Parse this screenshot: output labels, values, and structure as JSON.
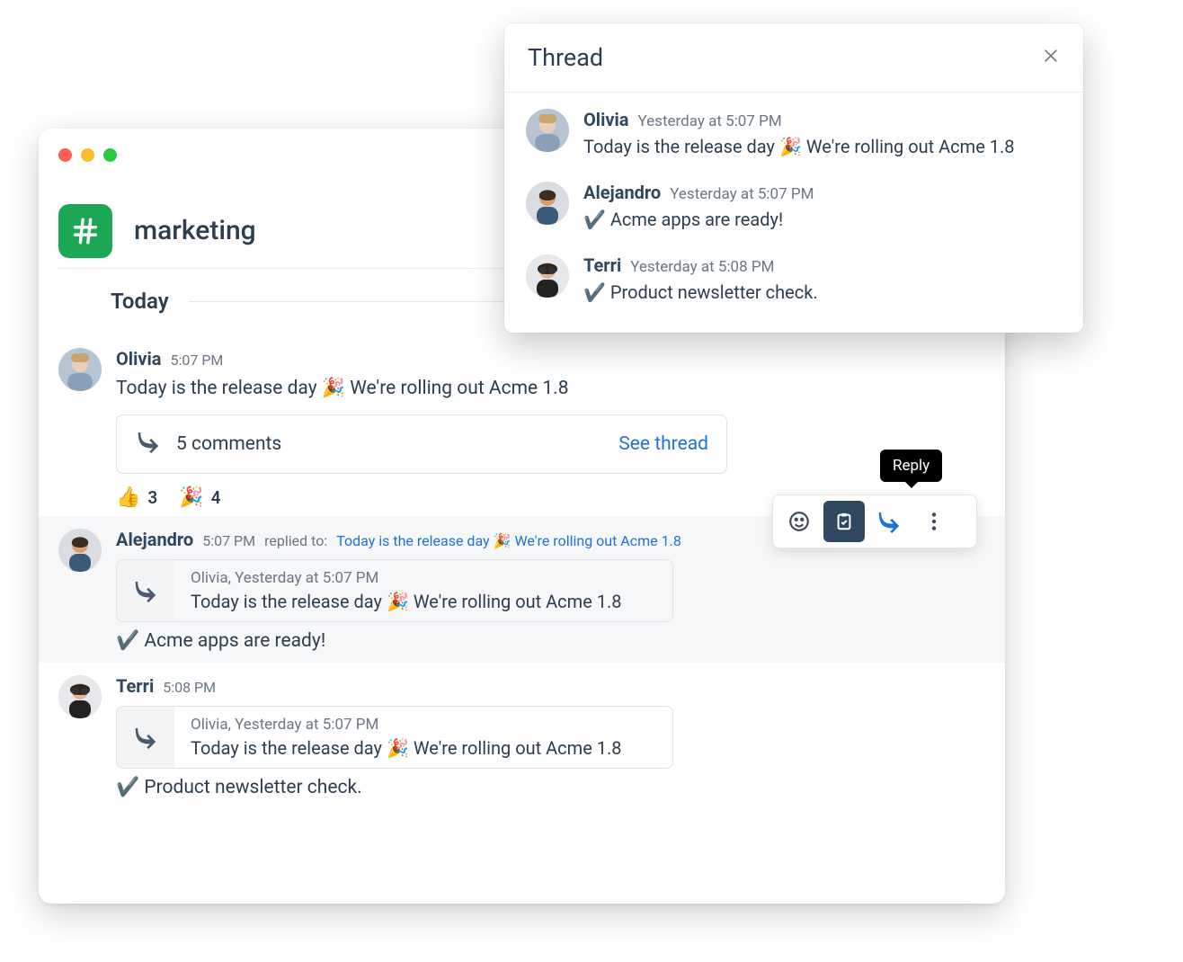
{
  "channel": {
    "name": "marketing",
    "icon": "hash-icon"
  },
  "divider_label": "Today",
  "icons": {
    "party": "🎉",
    "thumbs_up": "👍",
    "check": "✔️"
  },
  "messages": [
    {
      "author": "Olivia",
      "time": "5:07 PM",
      "text_pre": "Today is the release day ",
      "text_emoji": "🎉",
      "text_post": " We're rolling out Acme 1.8",
      "thread": {
        "count_label": "5 comments",
        "link_label": "See thread"
      },
      "reactions": [
        {
          "emoji": "👍",
          "count": "3"
        },
        {
          "emoji": "🎉",
          "count": "4"
        }
      ]
    },
    {
      "author": "Alejandro",
      "time": "5:07 PM",
      "replied_label": "replied to:",
      "replied_to_pre": "Today is the release day ",
      "replied_to_emoji": "🎉",
      "replied_to_post": " We're rolling out Acme 1.8",
      "quote": {
        "meta": "Olivia, Yesterday at 5:07 PM",
        "text_pre": "Today is the release day ",
        "text_emoji": "🎉",
        "text_post": " We're rolling out Acme 1.8"
      },
      "reply_emoji": "✔️",
      "reply_text": " Acme apps are ready!"
    },
    {
      "author": "Terri",
      "time": "5:08 PM",
      "quote": {
        "meta": "Olivia, Yesterday at 5:07 PM",
        "text_pre": "Today is the release day ",
        "text_emoji": "🎉",
        "text_post": " We're rolling out Acme 1.8"
      },
      "reply_emoji": "✔️",
      "reply_text": " Product newsletter check."
    }
  ],
  "thread_pop": {
    "title": "Thread",
    "items": [
      {
        "author": "Olivia",
        "time": "Yesterday at 5:07 PM",
        "text_pre": "Today is the release day ",
        "text_emoji": "🎉",
        "text_post": " We're rolling out Acme 1.8"
      },
      {
        "author": "Alejandro",
        "time": "Yesterday at 5:07 PM",
        "text_emoji": "✔️",
        "text_post": " Acme apps are ready!"
      },
      {
        "author": "Terri",
        "time": "Yesterday at 5:08 PM",
        "text_emoji": "✔️",
        "text_post": " Product newsletter check."
      }
    ]
  },
  "action_bar": {
    "tooltip": "Reply",
    "buttons": [
      "emoji",
      "task",
      "reply",
      "more"
    ]
  },
  "colors": {
    "accent_green": "#1aa854",
    "link": "#1f72d6"
  }
}
